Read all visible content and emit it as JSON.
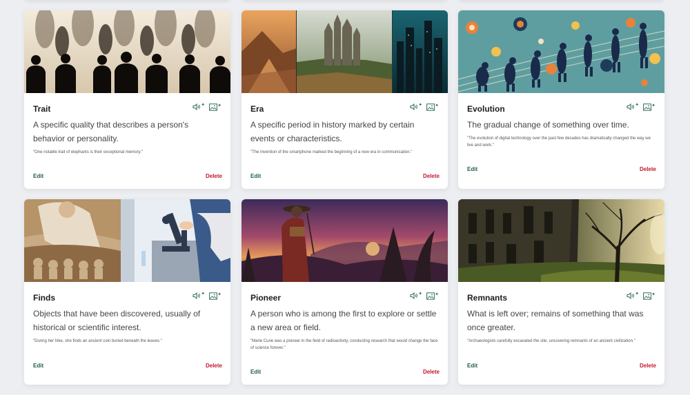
{
  "cards": [
    {
      "title": "Trait",
      "definition": "A specific quality that describes a person's behavior or personality.",
      "example": "\"One notable trait of elephants is their exceptional memory.\"",
      "edit": "Edit",
      "delete": "Delete",
      "image": "silhouettes-of-people-illustration"
    },
    {
      "title": "Era",
      "definition": "A specific period in history marked by certain events or characteristics.",
      "example": "\"The invention of the smartphone marked the beginning of a new era in communication.\"",
      "edit": "Edit",
      "delete": "Delete",
      "image": "pyramid-castle-skyline-illustration"
    },
    {
      "title": "Evolution",
      "definition": "The gradual change of something over time.",
      "example": "\"The evolution of digital technology over the past few decades has dramatically changed the way we live and work.\"",
      "edit": "Edit",
      "delete": "Delete",
      "image": "human-evolution-illustration"
    },
    {
      "title": "Finds",
      "definition": "Objects that have been discovered, usually of historical or scientific interest.",
      "example": "\"During her hike, she finds an ancient coin buried beneath the leaves.\"",
      "edit": "Edit",
      "delete": "Delete",
      "image": "excavation-and-microscope-illustration"
    },
    {
      "title": "Pioneer",
      "definition": "A person who is among the first to explore or settle a new area or field.",
      "example": "\"Marie Curie was a pioneer in the field of radioactivity, conducting research that would change the face of science forever.\"",
      "edit": "Edit",
      "delete": "Delete",
      "image": "explorer-at-sunset-illustration"
    },
    {
      "title": "Remnants",
      "definition": "What is left over; remains of something that was once greater.",
      "example": "\"Archaeologists carefully excavated the site, uncovering remnants of an ancient civilization.\"",
      "edit": "Edit",
      "delete": "Delete",
      "image": "castle-ruins-and-tree-illustration"
    }
  ],
  "icons": {
    "speaker": "speaker-icon",
    "image": "image-icon",
    "ai": "ai-sparkle-icon"
  },
  "colors": {
    "edit": "#1f5c4c",
    "delete": "#c4172c",
    "icon": "#2e6b57",
    "background": "#eceef2"
  }
}
